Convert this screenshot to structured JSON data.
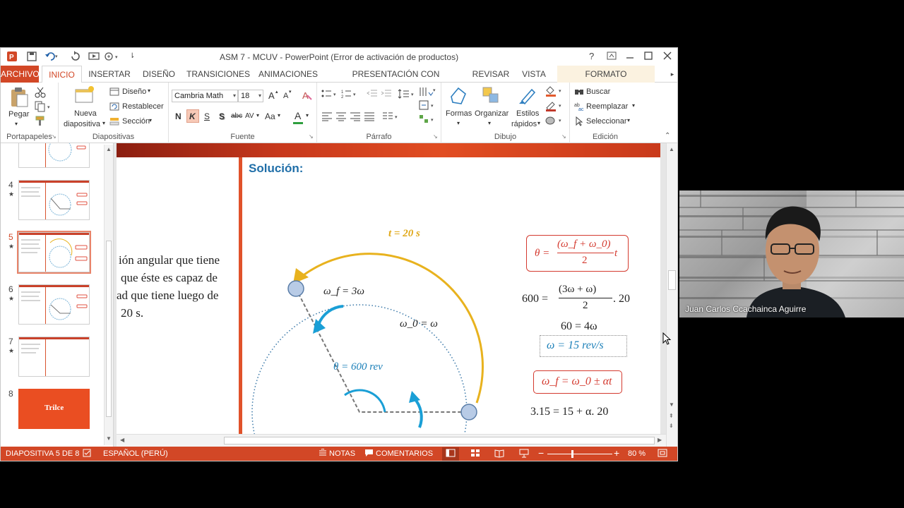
{
  "window": {
    "title": "ASM 7 - MCUV - PowerPoint (Error de activación de productos)",
    "help": "?",
    "controls": [
      "restore-ribbon",
      "minimize",
      "maximize",
      "close"
    ]
  },
  "tabs": [
    "ARCHIVO",
    "INICIO",
    "INSERTAR",
    "DISEÑO",
    "TRANSICIONES",
    "ANIMACIONES",
    "PRESENTACIÓN CON DIAPOSITIVAS",
    "REVISAR",
    "VISTA",
    "FORMATO"
  ],
  "ribbon": {
    "portapapeles": {
      "paste": "Pegar",
      "label": "Portapapeles"
    },
    "diapositivas": {
      "new_line1": "Nueva",
      "new_line2": "diapositiva",
      "layout": "Diseño",
      "reset": "Restablecer",
      "section": "Sección",
      "label": "Diapositivas"
    },
    "fuente": {
      "font": "Cambria Math",
      "size": "18",
      "bold": "N",
      "italic": "K",
      "underline": "S",
      "shadow": "S",
      "strike": "abc",
      "spacing": "AV",
      "case": "Aa",
      "color": "A",
      "grow": "A",
      "shrink": "A",
      "label": "Fuente"
    },
    "parrafo": {
      "label": "Párrafo"
    },
    "dibujo": {
      "shapes": "Formas",
      "arrange": "Organizar",
      "quick1": "Estilos",
      "quick2": "rápidos",
      "label": "Dibujo"
    },
    "edicion": {
      "find": "Buscar",
      "replace": "Reemplazar",
      "select": "Seleccionar",
      "label": "Edición"
    }
  },
  "thumbnails": [
    {
      "num": "",
      "star": ""
    },
    {
      "num": "4",
      "star": "★"
    },
    {
      "num": "5",
      "star": "★"
    },
    {
      "num": "6",
      "star": "★"
    },
    {
      "num": "7",
      "star": "★"
    },
    {
      "num": "8",
      "star": "",
      "logo": "Trilce"
    }
  ],
  "slide": {
    "heading": "Solución:",
    "left_text": [
      "ión angular que tiene",
      "que éste es capaz de",
      "ad que tiene luego de",
      "20 s."
    ],
    "diagram": {
      "time_label": "t = 20 s",
      "omega_f": "ω_f = 3ω",
      "omega_0": "ω_0 = ω",
      "theta": "θ = 600 rev"
    },
    "equations": {
      "eq1_lhs": "θ =",
      "eq1_num": "(ω_f + ω_0)",
      "eq1_den": "2",
      "eq1_tail": "t",
      "eq2_lhs": "600 =",
      "eq2_num": "(3ω  + ω)",
      "eq2_den": "2",
      "eq2_tail": ". 20",
      "eq3": "60 = 4ω",
      "eq4": "ω = 15 rev/s",
      "eq5": "ω_f = ω_0 ± αt",
      "eq6": "3.15 = 15 + α. 20"
    }
  },
  "statusbar": {
    "slide_info": "DIAPOSITIVA 5 DE 8",
    "language": "ESPAÑOL (PERÚ)",
    "notes": "NOTAS",
    "comments": "COMENTARIOS",
    "zoom": "80 %"
  },
  "webcam": {
    "participant": "Juan Carlos Ccachainca Aguirre"
  },
  "colors": {
    "accent": "#d24726",
    "slide_orange": "#e0522a",
    "arc_yellow": "#e8b21e",
    "arrow_blue": "#1a9fd6",
    "eq_red": "#d43a2f",
    "eq_blue": "#1a7fb8",
    "heading_blue": "#1f6ea8"
  }
}
